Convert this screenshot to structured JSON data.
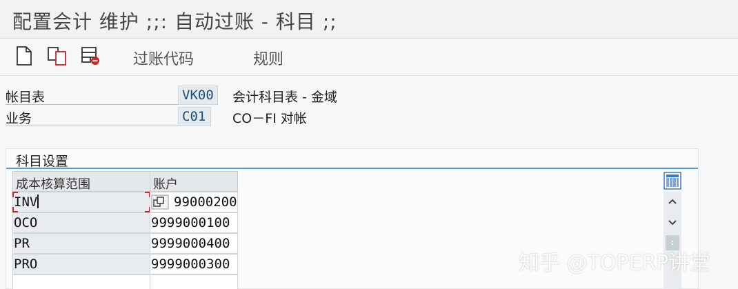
{
  "title": "配置会计 维护 ;;: 自动过账 - 科目 ;;",
  "toolbar": {
    "posting_key_label": "过账代码",
    "rules_label": "规则"
  },
  "fields": {
    "chart_of_accounts": {
      "label": "帐目表",
      "value": "VK00",
      "description": "会计科目表 - 金域"
    },
    "transaction": {
      "label": "业务",
      "value": "C01",
      "description": "CO－FI 对帐"
    }
  },
  "group": {
    "title": "科目设置"
  },
  "grid": {
    "columns": [
      "成本核算范围",
      "账户"
    ],
    "rows": [
      {
        "key": "INV",
        "account": "99000200"
      },
      {
        "key": "OCO",
        "account": "9999000100"
      },
      {
        "key": "PR",
        "account": "9999000400"
      },
      {
        "key": "PRO",
        "account": "9999000300"
      }
    ]
  },
  "watermark": "知乎 @TOPERP讲堂",
  "icons": [
    "new-document-icon",
    "copy-icon",
    "delete-icon",
    "column-settings-icon",
    "scroll-up-icon",
    "scroll-down-icon",
    "scroll-thumb-icon",
    "value-help-icon"
  ],
  "colors": {
    "accent_line": "#4aa0d8",
    "field_value_text": "#1b4f7a",
    "selection": "#c62828"
  }
}
